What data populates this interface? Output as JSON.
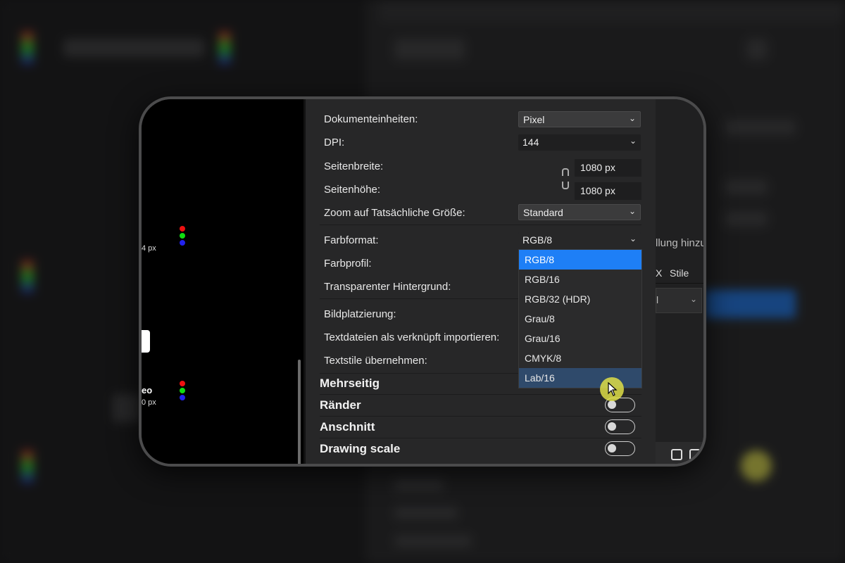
{
  "settings": {
    "document_units": {
      "label": "Dokumenteinheiten:",
      "value": "Pixel"
    },
    "dpi": {
      "label": "DPI:",
      "value": "144"
    },
    "page_width": {
      "label": "Seitenbreite:",
      "value": "1080 px"
    },
    "page_height": {
      "label": "Seitenhöhe:",
      "value": "1080 px"
    },
    "zoom": {
      "label": "Zoom auf Tatsächliche Größe:",
      "value": "Standard"
    },
    "color_format": {
      "label": "Farbformat:",
      "value": "RGB/8"
    },
    "color_profile": {
      "label": "Farbprofil:"
    },
    "transparent_bg": {
      "label": "Transparenter Hintergrund:"
    },
    "image_placement": {
      "label": "Bildplatzierung:"
    },
    "import_linked": {
      "label": "Textdateien als verknüpft importieren:"
    },
    "text_styles": {
      "label": "Textstile übernehmen:"
    }
  },
  "sections": {
    "multipage": {
      "label": "Mehrseitig"
    },
    "margins": {
      "label": "Ränder",
      "toggle_on": false
    },
    "bleed": {
      "label": "Anschnitt",
      "toggle_on": false
    },
    "drawing_scale": {
      "label": "Drawing scale",
      "toggle_on": false
    }
  },
  "color_format_dropdown": {
    "options": [
      "RGB/8",
      "RGB/16",
      "RGB/32 (HDR)",
      "Grau/8",
      "Grau/16",
      "CMYK/8",
      "Lab/16"
    ],
    "selected": "RGB/8",
    "hovered": "Lab/16"
  },
  "left_pane": {
    "size_1": "4 px",
    "name_2": "eo",
    "size_2": "0 px"
  },
  "right_pane": {
    "add_adjustment_fragment": "llung hinzu",
    "tab_close": "X",
    "tab_styles": "Stile",
    "select_fragment": "l"
  },
  "colors": {
    "accent": "#1e7ff6",
    "hover": "#2f4a6b",
    "panel_bg": "#272728",
    "cursor_highlight": "#dede46"
  }
}
